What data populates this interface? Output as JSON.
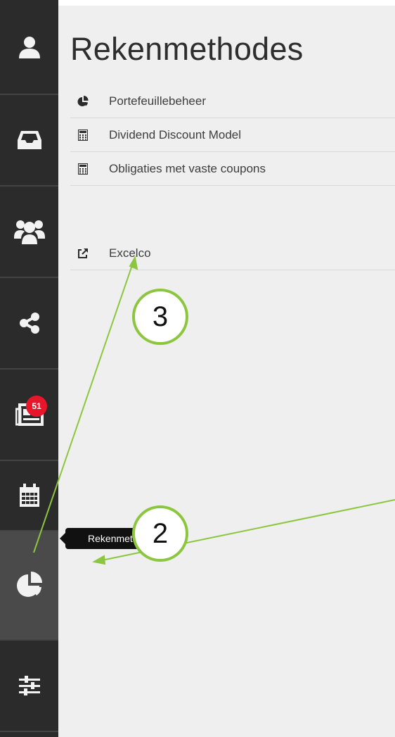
{
  "page": {
    "title": "Rekenmethodes"
  },
  "sidebar": {
    "items": [
      {
        "name": "user-icon"
      },
      {
        "name": "inbox-icon"
      },
      {
        "name": "users-icon"
      },
      {
        "name": "share-icon"
      },
      {
        "name": "newspaper-icon",
        "badge": "51"
      },
      {
        "name": "calendar-icon"
      },
      {
        "name": "pie-chart-icon",
        "active": true
      },
      {
        "name": "sliders-icon"
      }
    ]
  },
  "menu": {
    "items": [
      {
        "label": "Portefeuillebeheer",
        "icon": "pie-chart-icon"
      },
      {
        "label": "Dividend Discount Model",
        "icon": "calculator-icon"
      },
      {
        "label": "Obligaties met vaste coupons",
        "icon": "calculator-icon"
      },
      {
        "label": "Excelco",
        "icon": "external-link-icon"
      }
    ]
  },
  "tooltip": {
    "text": "Rekenmethodes"
  },
  "annotations": {
    "callout_3": "3",
    "callout_2": "2"
  },
  "colors": {
    "sidebar_bg": "#2b2b2b",
    "active_bg": "#4a4a4a",
    "badge": "#e8152b",
    "callout_green": "#8cc63f",
    "content_bg": "#efefef"
  }
}
